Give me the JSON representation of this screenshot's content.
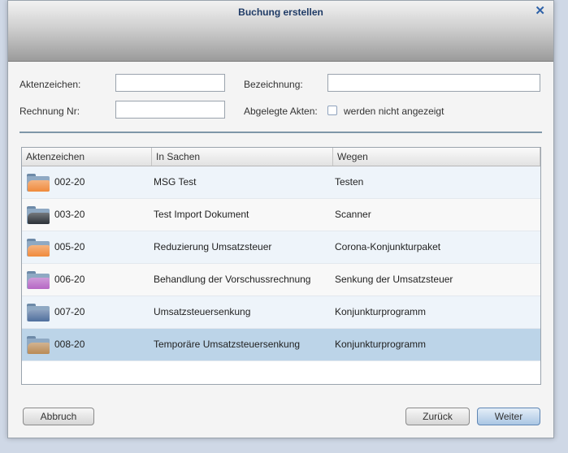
{
  "dialog": {
    "title": "Buchung erstellen",
    "close_glyph": "✕"
  },
  "form": {
    "aktenzeichen_label": "Aktenzeichen:",
    "aktenzeichen_value": "",
    "rechnung_label": "Rechnung Nr:",
    "rechnung_value": "",
    "bezeichnung_label": "Bezeichnung:",
    "bezeichnung_value": "",
    "abgelegte_label": "Abgelegte Akten:",
    "abgelegte_checkbox_label": "werden nicht angezeigt",
    "abgelegte_checked": false
  },
  "grid": {
    "columns": [
      "Aktenzeichen",
      "In Sachen",
      "Wegen"
    ],
    "rows": [
      {
        "aktenzeichen": "002-20",
        "in_sachen": "MSG Test",
        "wegen": "Testen",
        "folder_color": "#f08a3c",
        "folder_icon": "folder-icon",
        "selected": false
      },
      {
        "aktenzeichen": "003-20",
        "in_sachen": "Test Import Dokument",
        "wegen": "Scanner",
        "folder_color": "#2b3138",
        "folder_icon": "folder-icon",
        "selected": false
      },
      {
        "aktenzeichen": "005-20",
        "in_sachen": "Reduzierung Umsatzsteuer",
        "wegen": "Corona-Konjunkturpaket",
        "folder_color": "#f08a3c",
        "folder_icon": "folder-icon",
        "selected": false
      },
      {
        "aktenzeichen": "006-20",
        "in_sachen": "Behandlung der Vorschussrechnung",
        "wegen": "Senkung der Umsatzsteuer",
        "folder_color": "#b566c4",
        "folder_icon": "folder-icon",
        "selected": false
      },
      {
        "aktenzeichen": "007-20",
        "in_sachen": "Umsatzsteuersenkung",
        "wegen": "Konjunkturprogramm",
        "folder_color": "#4f6f9d",
        "folder_icon": "folder-icon",
        "selected": false
      },
      {
        "aktenzeichen": "008-20",
        "in_sachen": "Temporäre Umsatzsteuersenkung",
        "wegen": "Konjunkturprogramm",
        "folder_color": "#b98a55",
        "folder_icon": "folder-icon",
        "selected": true
      }
    ]
  },
  "buttons": {
    "abbruch": "Abbruch",
    "zurueck": "Zurück",
    "weiter": "Weiter"
  },
  "colors": {
    "title_text": "#1f3b66",
    "accent": "#2f62a8",
    "selected_row": "#bcd4e8"
  }
}
